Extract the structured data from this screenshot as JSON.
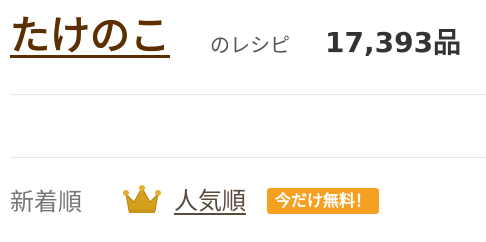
{
  "colors": {
    "brand": "#5b2f00",
    "accent": "#f5a020",
    "crown": "#d4a01a"
  },
  "header": {
    "title": "たけのこ",
    "subtitle": "のレシピ",
    "count": "17,393品"
  },
  "sort": {
    "newest_label": "新着順",
    "popular_label": "人気順",
    "crown_icon": "crown-icon",
    "promo_badge": "今だけ無料！"
  }
}
